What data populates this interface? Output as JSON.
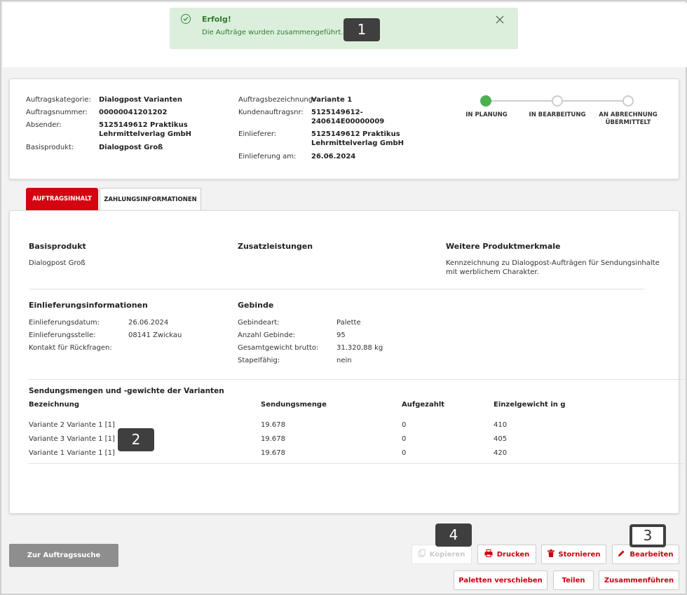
{
  "toast": {
    "title": "Erfolg!",
    "message": "Die Aufträge wurden zusammengeführt.",
    "color": "#dcefdc"
  },
  "markers": [
    "1",
    "2",
    "3",
    "4"
  ],
  "header": {
    "col1": [
      {
        "key": "Auftragskategorie:",
        "value": "Dialogpost Varianten"
      },
      {
        "key": "Auftragsnummer:",
        "value": "00000041201202"
      },
      {
        "key": "Absender:",
        "value_lines": [
          "5125149612 Praktikus",
          "Lehrmittelverlag GmbH"
        ]
      },
      {
        "key": "Basisprodukt:",
        "value": "Dialogpost Groß"
      }
    ],
    "col2": [
      {
        "key": "Auftragsbezeichnung:",
        "value": "Variante 1"
      },
      {
        "key": "Kundenauftragsnr:",
        "value_lines": [
          "5125149612-",
          "240614E00000009"
        ]
      },
      {
        "key": "Einlieferer:",
        "value_lines": [
          "5125149612 Praktikus",
          "Lehrmittelverlag GmbH"
        ]
      },
      {
        "key": "Einlieferung am:",
        "value": "26.06.2024"
      }
    ],
    "steps": [
      {
        "label": "IN PLANUNG",
        "active": true
      },
      {
        "label": "IN BEARBEITUNG",
        "active": false
      },
      {
        "label_lines": [
          "AN ABRECHNUNG",
          "ÜBERMITTELT"
        ],
        "active": false
      }
    ]
  },
  "tabs": [
    "AUFTRAGSINHALT",
    "ZAHLUNGSINFORMATIONEN"
  ],
  "content": {
    "basisprodukt": {
      "title": "Basisprodukt",
      "value": "Dialogpost Groß"
    },
    "zusatz": {
      "title": "Zusatzleistungen"
    },
    "weitere": {
      "title": "Weitere Produktmerkmale",
      "lines": [
        "Kennzeichnung zu Dialogpost-Aufträgen für Sendungsinhalte",
        "mit werblichem Charakter."
      ]
    },
    "einlieferung": {
      "title": "Einlieferungsinformationen",
      "rows": [
        {
          "key": "Einlieferungsdatum:",
          "value": "26.06.2024"
        },
        {
          "key": "Einlieferungsstelle:",
          "value": "08141 Zwickau"
        },
        {
          "key": "Kontakt für Rückfragen:",
          "value": ""
        }
      ]
    },
    "gebinde": {
      "title": "Gebinde",
      "rows": [
        {
          "key": "Gebindeart:",
          "value": "Palette"
        },
        {
          "key": "Anzahl Gebinde:",
          "value": "95"
        },
        {
          "key": "Gesamtgewicht brutto:",
          "value": "31.320,88 kg"
        },
        {
          "key": "Stapelfähig:",
          "value": "nein"
        }
      ]
    },
    "varianten": {
      "title": "Sendungsmengen und -gewichte der Varianten",
      "columns": [
        "Bezeichnung",
        "Sendungsmenge",
        "Aufgezahlt",
        "Einzelgewicht in g"
      ],
      "rows": [
        [
          "Variante 2 Variante 1 [1]",
          "19.678",
          "0",
          "410"
        ],
        [
          "Variante 3 Variante 1 [1]",
          "19.678",
          "0",
          "405"
        ],
        [
          "Variante 1 Variante 1 [1]",
          "19.678",
          "0",
          "420"
        ]
      ]
    }
  },
  "buttons": {
    "back": "Zur Auftragssuche",
    "kopieren": "Kopieren",
    "drucken": "Drucken",
    "stornieren": "Stornieren",
    "bearbeiten": "Bearbeiten",
    "paletten": "Paletten verschieben",
    "teilen": "Teilen",
    "zusammen": "Zusammenführen"
  },
  "colors": {
    "brand_red": "#d40511",
    "success_green": "#4caf50"
  }
}
